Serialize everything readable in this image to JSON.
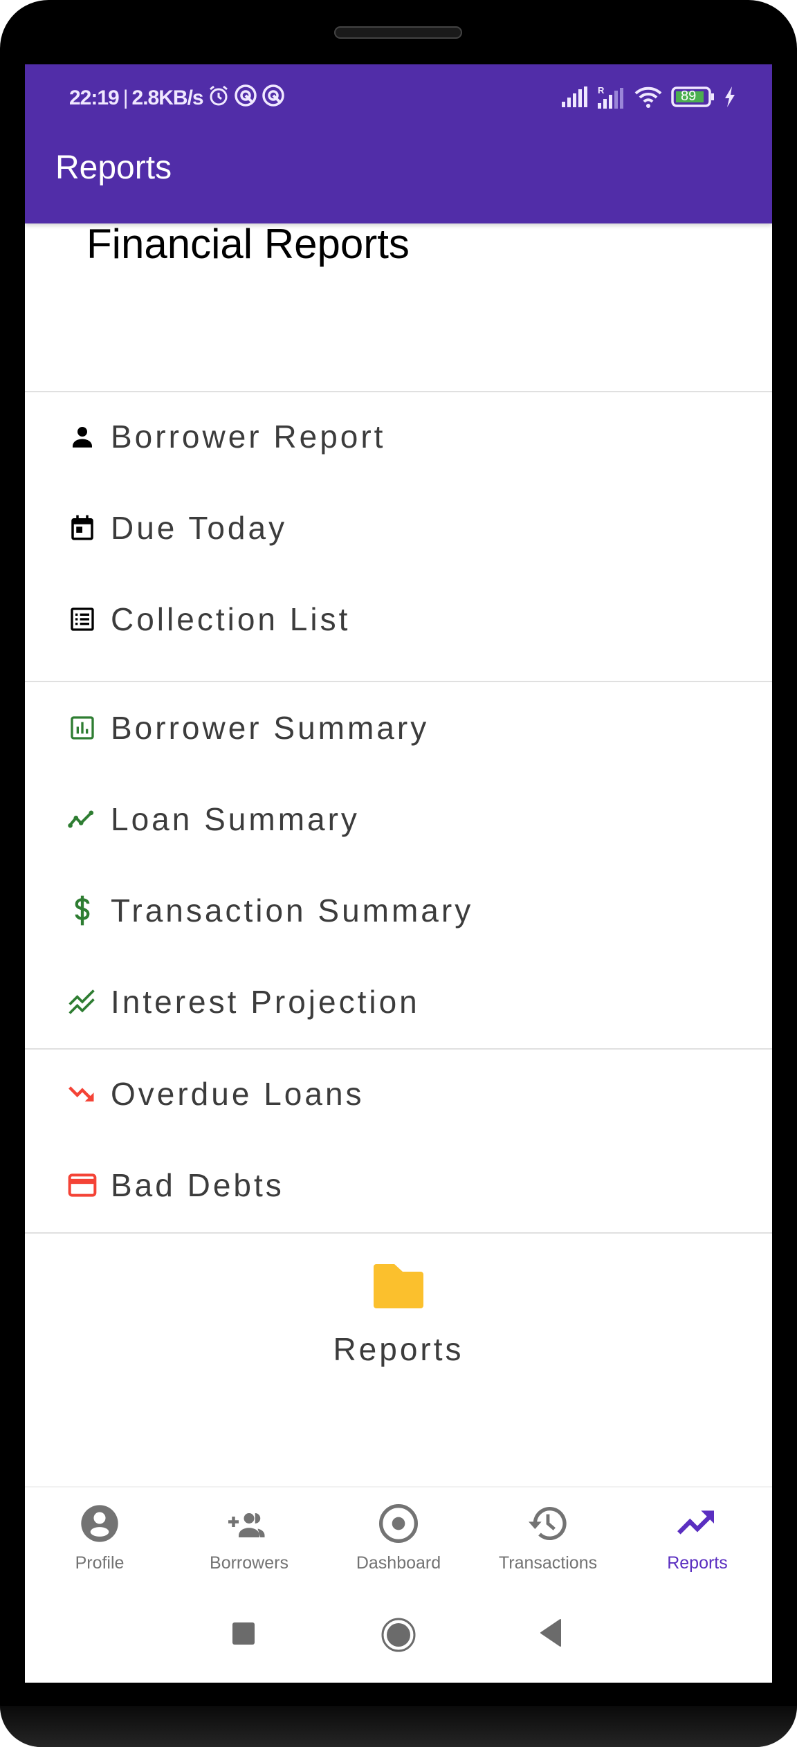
{
  "status_bar": {
    "time": "22:19",
    "net_speed": "2.8KB/s",
    "battery": "89",
    "icons_left": [
      "alarm-icon",
      "vpn-icon",
      "vpn-icon"
    ],
    "icons_right": [
      "signal-icon",
      "signal-roaming-icon",
      "wifi-icon",
      "battery-icon",
      "charging-icon"
    ]
  },
  "app_bar": {
    "title": "Reports"
  },
  "main": {
    "heading": "Financial Reports",
    "groups": [
      {
        "items": [
          {
            "label": "Borrower Report",
            "icon": "person-icon",
            "color": "#000000"
          },
          {
            "label": "Due Today",
            "icon": "calendar-icon",
            "color": "#000000"
          },
          {
            "label": "Collection List",
            "icon": "list-icon",
            "color": "#000000"
          }
        ]
      },
      {
        "items": [
          {
            "label": "Borrower Summary",
            "icon": "bar-chart-icon",
            "color": "#2E7D32"
          },
          {
            "label": "Loan Summary",
            "icon": "trend-line-icon",
            "color": "#2E7D32"
          },
          {
            "label": "Transaction Summary",
            "icon": "dollar-icon",
            "color": "#2E7D32"
          },
          {
            "label": "Interest Projection",
            "icon": "stacked-trend-icon",
            "color": "#2E7D32"
          }
        ]
      },
      {
        "items": [
          {
            "label": "Overdue Loans",
            "icon": "trending-down-icon",
            "color": "#F44336"
          },
          {
            "label": "Bad Debts",
            "icon": "credit-card-icon",
            "color": "#F44336"
          }
        ]
      }
    ],
    "footer": {
      "icon": "folder-icon",
      "label": "Reports",
      "color": "#FBC02D"
    }
  },
  "bottom_nav": {
    "items": [
      {
        "label": "Profile",
        "icon": "account-circle-icon",
        "active": false
      },
      {
        "label": "Borrowers",
        "icon": "group-add-icon",
        "active": false
      },
      {
        "label": "Dashboard",
        "icon": "radio-button-icon",
        "active": false
      },
      {
        "label": "Transactions",
        "icon": "history-icon",
        "active": false
      },
      {
        "label": "Reports",
        "icon": "trending-up-icon",
        "active": true
      }
    ],
    "active_color": "#5A2EC0",
    "inactive_color": "#737373"
  },
  "system_nav": {
    "buttons": [
      "recents",
      "home",
      "back"
    ]
  },
  "colors": {
    "primary": "#512DA8",
    "text": "#3C3C3C",
    "divider": "#E0E0E0"
  }
}
